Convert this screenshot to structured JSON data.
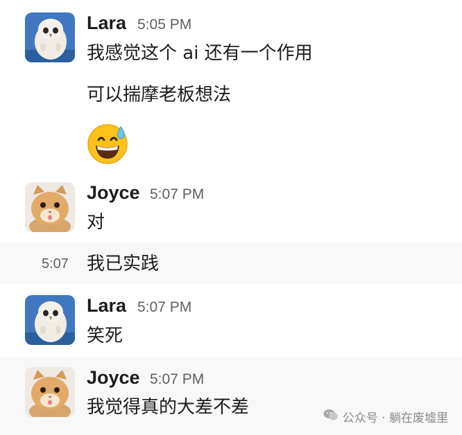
{
  "messages": [
    {
      "author": "Lara",
      "time": "5:05 PM",
      "avatar_icon": "owl-plush-avatar",
      "lines": [
        "我感觉这个 ai 还有一个作用",
        "可以揣摩老板想法"
      ],
      "emoji": "grinning-face-with-sweat-icon"
    },
    {
      "author": "Joyce",
      "time": "5:07 PM",
      "avatar_icon": "cat-avatar",
      "lines": [
        "对"
      ]
    },
    {
      "short_time": "5:07",
      "lines": [
        "我已实践"
      ]
    },
    {
      "author": "Lara",
      "time": "5:07 PM",
      "avatar_icon": "owl-plush-avatar",
      "lines": [
        "笑死"
      ]
    },
    {
      "author": "Joyce",
      "time": "5:07 PM",
      "avatar_icon": "cat-avatar",
      "lines": [
        "我觉得真的大差不差"
      ]
    }
  ],
  "watermark": {
    "icon": "wechat-icon",
    "text": "公众号 · 躺在废墟里"
  },
  "colors": {
    "hover_background": "#f8f8f8",
    "text": "#1d1c1d",
    "timestamp": "#616061"
  }
}
